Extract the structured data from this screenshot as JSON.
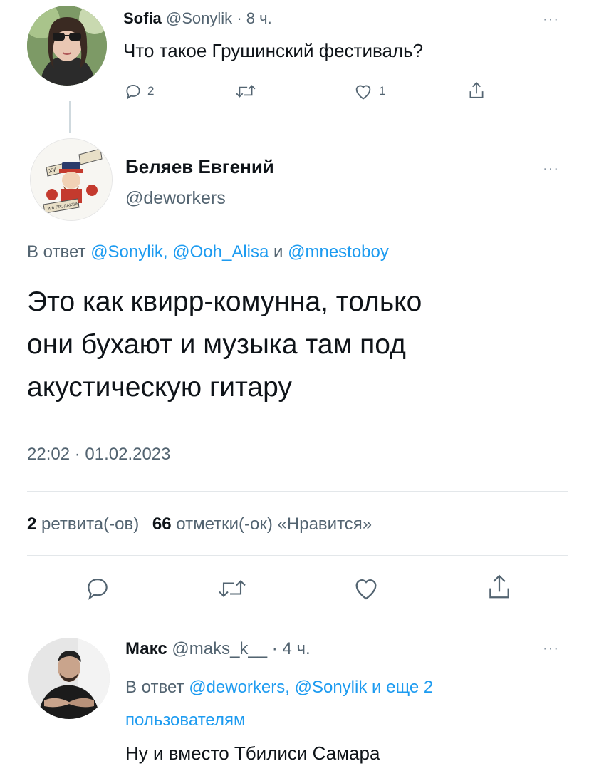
{
  "tweet1": {
    "name": "Sofia",
    "handle": "@Sonylik",
    "sep": "·",
    "time": "8 ч.",
    "text": "Что такое Грушинский фестиваль?",
    "reply_count": "2",
    "like_count": "1"
  },
  "main": {
    "name": "Беляев Евгений",
    "handle": "@deworkers",
    "reply_prefix": "В ответ",
    "reply_to_1": "@Sonylik,",
    "reply_to_2": "@Ooh_Alisa",
    "reply_and": "и",
    "reply_to_3": "@mnestoboy",
    "text_line1": "Это как квирр-комунна, только",
    "text_line2": "они бухают и музыка там под",
    "text_line3": "акустическую гитару",
    "timestamp": "22:02 · 01.02.2023",
    "retweets_num": "2",
    "retweets_label": "ретвита(-ов)",
    "likes_num": "66",
    "likes_label": "отметки(-ок) «Нравится»",
    "avatar_text_top": "ХУ",
    "avatar_text_bottom": "И В ПРОДАКШН"
  },
  "reply": {
    "name": "Макс",
    "handle": "@maks_k__",
    "sep": "·",
    "time": "4 ч.",
    "reply_prefix": "В ответ",
    "reply_to_1": "@deworkers,",
    "reply_to_2": "@Sonylik",
    "reply_more": "и еще 2",
    "reply_more_line2": "пользователям",
    "text": "Ну и вместо Тбилиси Самара"
  },
  "icons": {
    "reply": "reply-icon",
    "retweet": "retweet-icon",
    "like": "heart-icon",
    "share": "share-icon",
    "more": "more-icon"
  },
  "colors": {
    "accent": "#1d9bf0",
    "muted": "#536471",
    "text": "#0f1419"
  }
}
